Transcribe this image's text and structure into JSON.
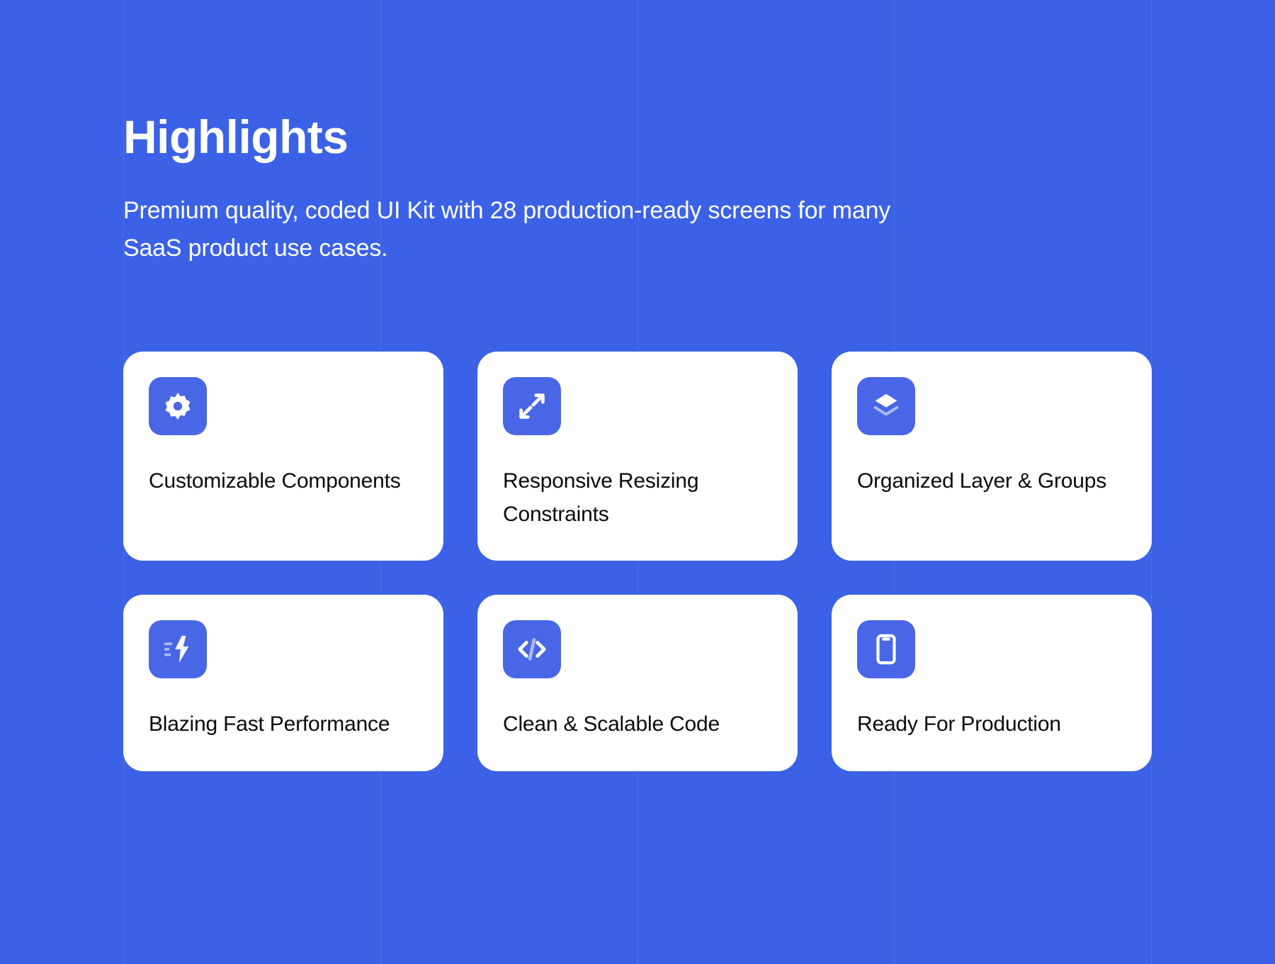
{
  "header": {
    "title": "Highlights",
    "subtitle": "Premium quality, coded UI Kit with 28 production-ready screens for many SaaS product use cases."
  },
  "cards": [
    {
      "title": "Customizable Components",
      "icon": "gear"
    },
    {
      "title": "Responsive Resizing Constraints",
      "icon": "resize"
    },
    {
      "title": "Organized Layer & Groups",
      "icon": "layers"
    },
    {
      "title": "Blazing Fast Performance",
      "icon": "bolt"
    },
    {
      "title": "Clean & Scalable Code",
      "icon": "code"
    },
    {
      "title": "Ready For Production",
      "icon": "phone"
    }
  ]
}
